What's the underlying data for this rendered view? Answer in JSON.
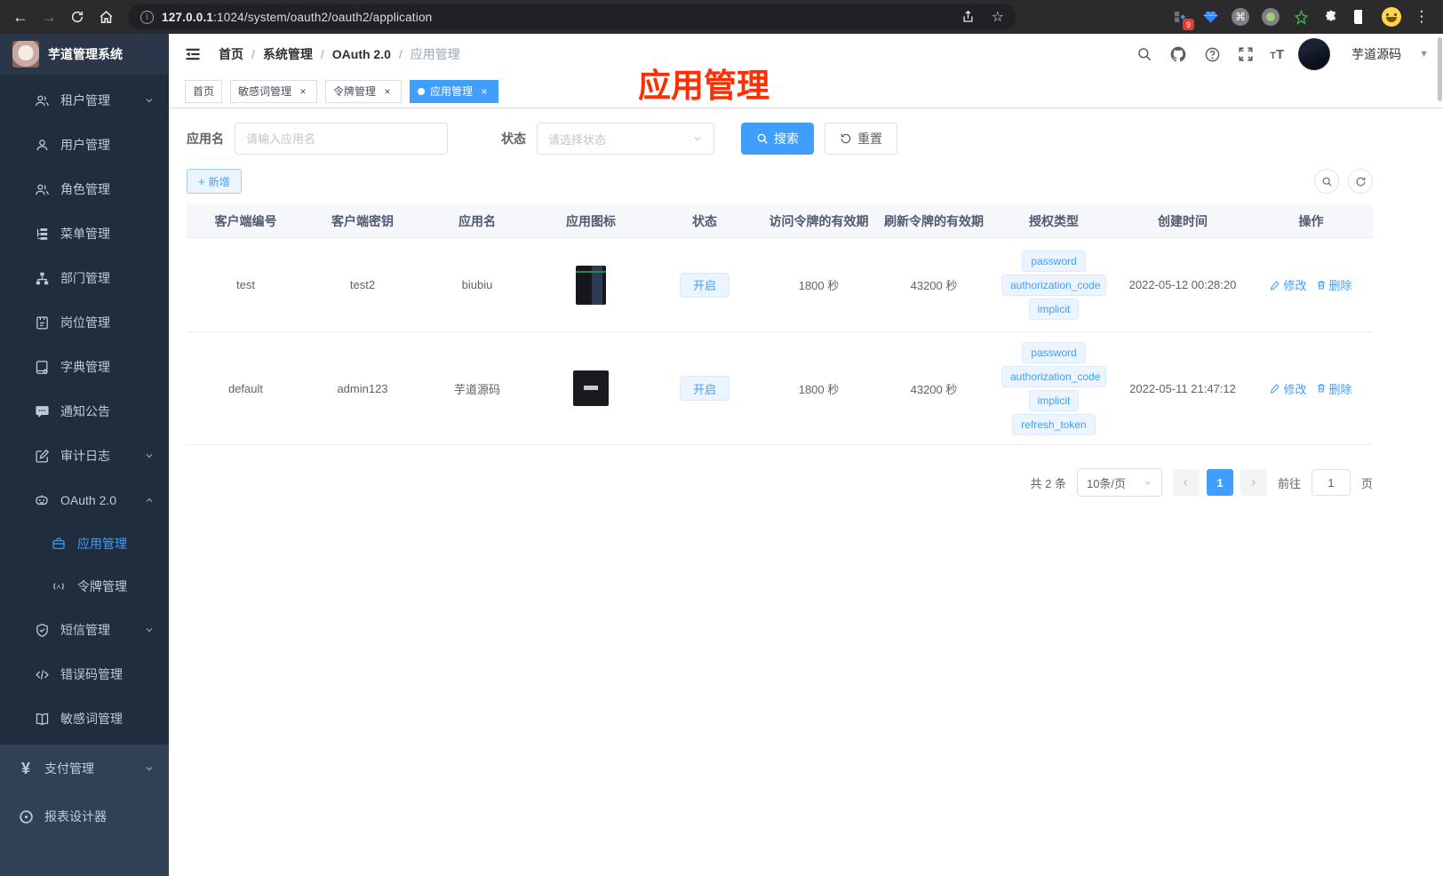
{
  "browser": {
    "url_host": "127.0.0.1",
    "url_path": ":1024/system/oauth2/oauth2/application",
    "extension_badge": "9"
  },
  "sidebar": {
    "title": "芋道管理系统",
    "items": [
      {
        "label": "租户管理"
      },
      {
        "label": "用户管理"
      },
      {
        "label": "角色管理"
      },
      {
        "label": "菜单管理"
      },
      {
        "label": "部门管理"
      },
      {
        "label": "岗位管理"
      },
      {
        "label": "字典管理"
      },
      {
        "label": "通知公告"
      },
      {
        "label": "审计日志"
      },
      {
        "label": "OAuth 2.0"
      },
      {
        "label": "应用管理"
      },
      {
        "label": "令牌管理"
      },
      {
        "label": "短信管理"
      },
      {
        "label": "错误码管理"
      },
      {
        "label": "敏感词管理"
      },
      {
        "label": "支付管理"
      },
      {
        "label": "报表设计器"
      }
    ]
  },
  "navbar": {
    "breadcrumb": [
      "首页",
      "系统管理",
      "OAuth 2.0",
      "应用管理"
    ],
    "separator": "/",
    "username": "芋道源码"
  },
  "tabs": [
    {
      "label": "首页"
    },
    {
      "label": "敏感词管理"
    },
    {
      "label": "令牌管理"
    },
    {
      "label": "应用管理"
    }
  ],
  "annotation": {
    "text": "应用管理",
    "color": "#ff2e00"
  },
  "filters": {
    "name_label": "应用名",
    "name_placeholder": "请输入应用名",
    "status_label": "状态",
    "status_placeholder": "请选择状态",
    "search_label": "搜索",
    "reset_label": "重置",
    "add_label": "新增"
  },
  "table": {
    "columns": [
      "客户端编号",
      "客户端密钥",
      "应用名",
      "应用图标",
      "状态",
      "访问令牌的有效期",
      "刷新令牌的有效期",
      "授权类型",
      "创建时间",
      "操作"
    ],
    "rows": [
      {
        "client_id": "test",
        "client_secret": "test2",
        "app_name": "biubiu",
        "status": "开启",
        "access_token_validity": "1800 秒",
        "refresh_token_validity": "43200 秒",
        "grant_types": [
          "password",
          "authorization_code",
          "implicit"
        ],
        "create_time": "2022-05-12 00:28:20",
        "edit_label": "修改",
        "delete_label": "删除"
      },
      {
        "client_id": "default",
        "client_secret": "admin123",
        "app_name": "芋道源码",
        "status": "开启",
        "access_token_validity": "1800 秒",
        "refresh_token_validity": "43200 秒",
        "grant_types": [
          "password",
          "authorization_code",
          "implicit",
          "refresh_token"
        ],
        "create_time": "2022-05-11 21:47:12",
        "edit_label": "修改",
        "delete_label": "删除"
      }
    ]
  },
  "pagination": {
    "total": "共 2 条",
    "page_size": "10条/页",
    "page": "1",
    "goto_label": "前往",
    "goto_value": "1",
    "unit_label": "页"
  },
  "icons": {
    "browser": [
      "back-arrow",
      "forward-arrow",
      "reload",
      "home",
      "info-circle",
      "share",
      "bookmark-star",
      "extension-badge",
      "gem",
      "command-circle",
      "record-circle",
      "green-star",
      "puzzle",
      "split-square",
      "emoji-avatar",
      "kebab-menu"
    ],
    "navbar": [
      "hamburger-fold",
      "search",
      "github",
      "help-circle",
      "fullscreen",
      "font-size",
      "caret-down"
    ],
    "toolbar": [
      "plus",
      "search-circle",
      "refresh-circle"
    ],
    "actions": [
      "edit-pencil",
      "delete-trash"
    ]
  },
  "colors": {
    "primary": "#409eff",
    "sidebar_bg": "#304156",
    "submenu_bg": "#1f2d3d",
    "tag_bg": "#ecf5ff",
    "annotation_red": "#ff2e00",
    "browser_bar": "#2b2b2e"
  }
}
